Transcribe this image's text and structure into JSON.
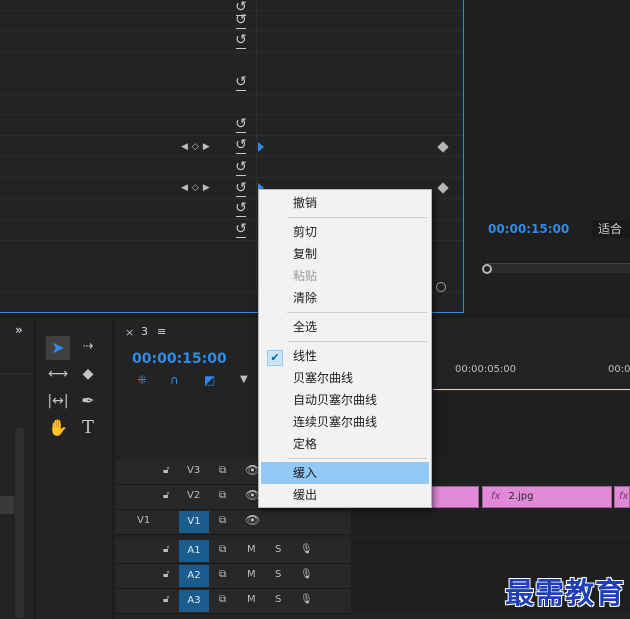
{
  "program_monitor": {
    "timecode": "00:00:15:00",
    "fit_label": "适合"
  },
  "timeline": {
    "tab_close": "×",
    "tab_name": "3",
    "tab_menu": "≡",
    "timecode": "00:00:15:00",
    "ruler_label": "00:00:05:00",
    "ruler_label_cut": "00:00:10",
    "tracks": [
      {
        "name": "V3",
        "source": ""
      },
      {
        "name": "V2",
        "source": ""
      },
      {
        "name": "V1",
        "source": "V1"
      },
      {
        "name": "A1",
        "source": ""
      },
      {
        "name": "A2",
        "source": ""
      },
      {
        "name": "A3",
        "source": ""
      }
    ],
    "audio_m": "M",
    "audio_s": "S",
    "clip_fx": "fx",
    "clip_name": "2.jpg",
    "clip2_fx": "fx"
  },
  "context_menu": {
    "items": [
      {
        "label": "撤销",
        "state": "normal"
      },
      {
        "label": "剪切",
        "state": "normal"
      },
      {
        "label": "复制",
        "state": "normal"
      },
      {
        "label": "粘贴",
        "state": "disabled"
      },
      {
        "label": "清除",
        "state": "normal"
      },
      {
        "label": "全选",
        "state": "normal"
      },
      {
        "label": "线性",
        "state": "checked"
      },
      {
        "label": "贝塞尔曲线",
        "state": "normal"
      },
      {
        "label": "自动贝塞尔曲线",
        "state": "normal"
      },
      {
        "label": "连续贝塞尔曲线",
        "state": "normal"
      },
      {
        "label": "定格",
        "state": "normal"
      },
      {
        "label": "缓入",
        "state": "highlighted"
      },
      {
        "label": "缓出",
        "state": "normal"
      }
    ]
  },
  "watermark": "最需教育",
  "colors": {
    "accent": "#2d8ceb",
    "playhead": "#f5ef22",
    "clip": "#e08ad8",
    "track_target": "#1a5c8e",
    "menu_highlight": "#91c9f7"
  }
}
